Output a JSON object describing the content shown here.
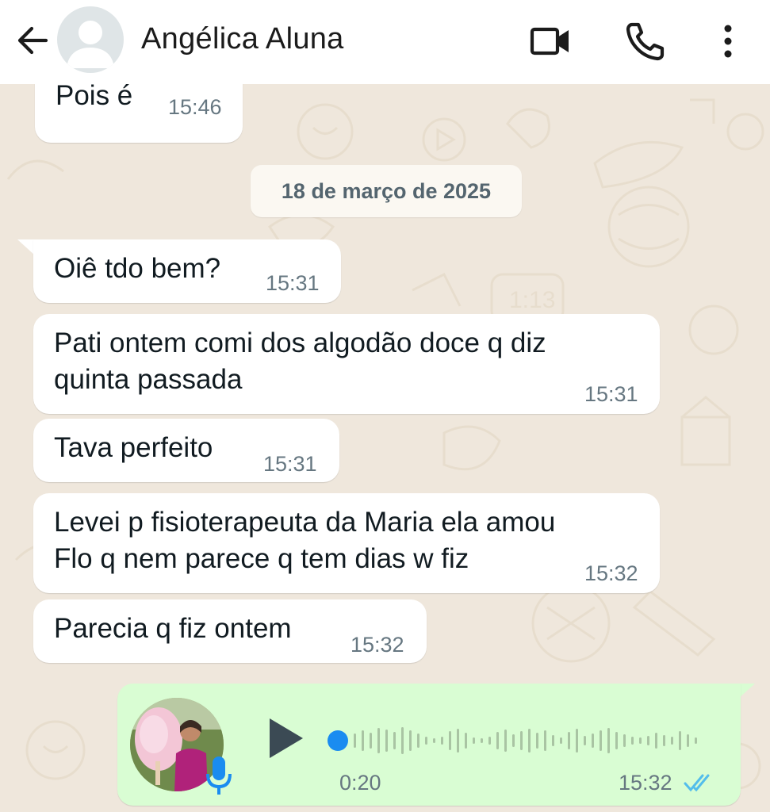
{
  "header": {
    "contact_name": "Angélica Aluna",
    "back_icon": "arrow-left-icon",
    "video_icon": "video-call-icon",
    "phone_icon": "phone-call-icon",
    "menu_icon": "more-vertical-icon"
  },
  "messages": [
    {
      "text": "Pois é",
      "time": "15:46"
    },
    {
      "text": "Oiê tdo bem?",
      "time": "15:31"
    },
    {
      "text": "Pati ontem comi dos algodão doce q diz\nquinta passada",
      "time": "15:31"
    },
    {
      "text": "Tava perfeito",
      "time": "15:31"
    },
    {
      "text": "Levei p fisioterapeuta da Maria ela amou\nFlo q nem parece q tem dias w fiz",
      "time": "15:32"
    },
    {
      "text": "Parecia q fiz ontem",
      "time": "15:32"
    }
  ],
  "date_separator": "18 de março de 2025",
  "voice_message": {
    "duration": "0:20",
    "time": "15:32",
    "status": "read",
    "progress": 0
  },
  "colors": {
    "incoming_bubble": "#ffffff",
    "outgoing_bubble": "#d9fdd3",
    "background": "#efe7dc",
    "read_ticks": "#53bdeb",
    "progress_dot": "#1a8cf0"
  }
}
